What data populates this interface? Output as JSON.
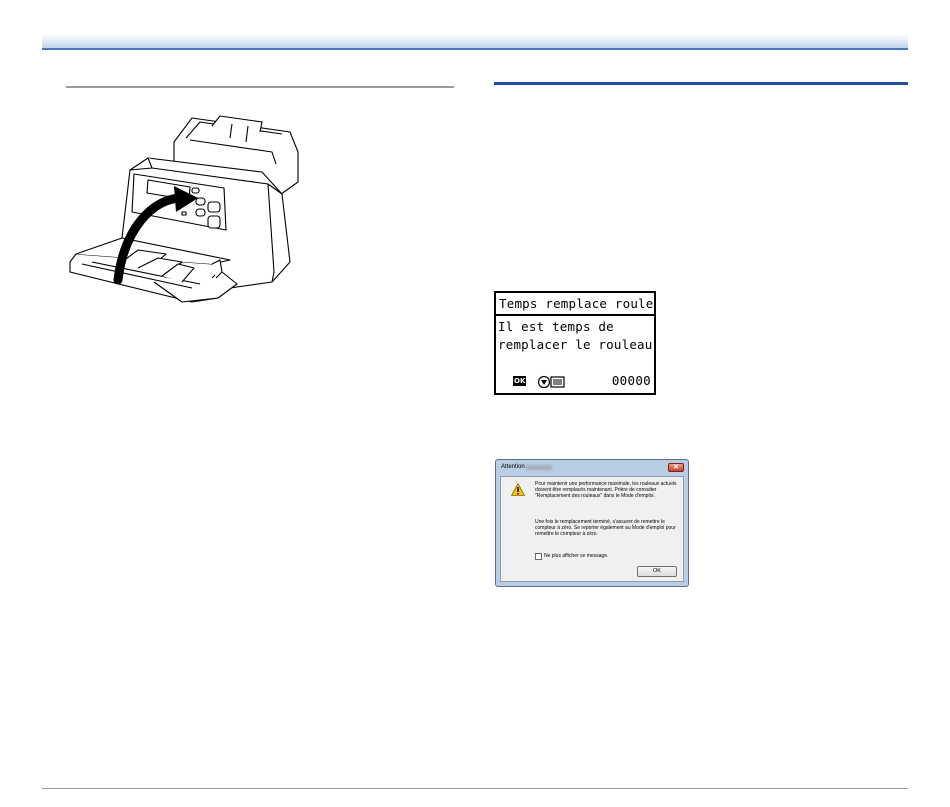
{
  "lcd": {
    "title": "Temps remplace rouleau",
    "line1": "Il est temps de",
    "line2": "remplacer le rouleau.",
    "ok_icon": "OK",
    "counter": "00000",
    "icons": [
      "ok-icon",
      "roller-icon"
    ]
  },
  "dialog": {
    "title": "Attention",
    "close_label": "✕",
    "message_1": "Pour maintenir une performance maximale, les rouleaux actuels doivent être remplacés maintenant. Prière de consulter \"Remplacement des rouleaux\" dans le Mode d'emploi.",
    "message_2": "Une fois le remplacement terminé, s'assurer de remettre le compteur à zéro. Se reporter également au Mode d'emploi pour remettre le compteur à zéro.",
    "checkbox_label": "Ne plus afficher ce message.",
    "ok_label": "OK",
    "icon": "warning-icon"
  },
  "colors": {
    "header_accent": "#4a78be",
    "section_rule": "#1f4fa8",
    "dialog_frame": "#b9cde4"
  }
}
